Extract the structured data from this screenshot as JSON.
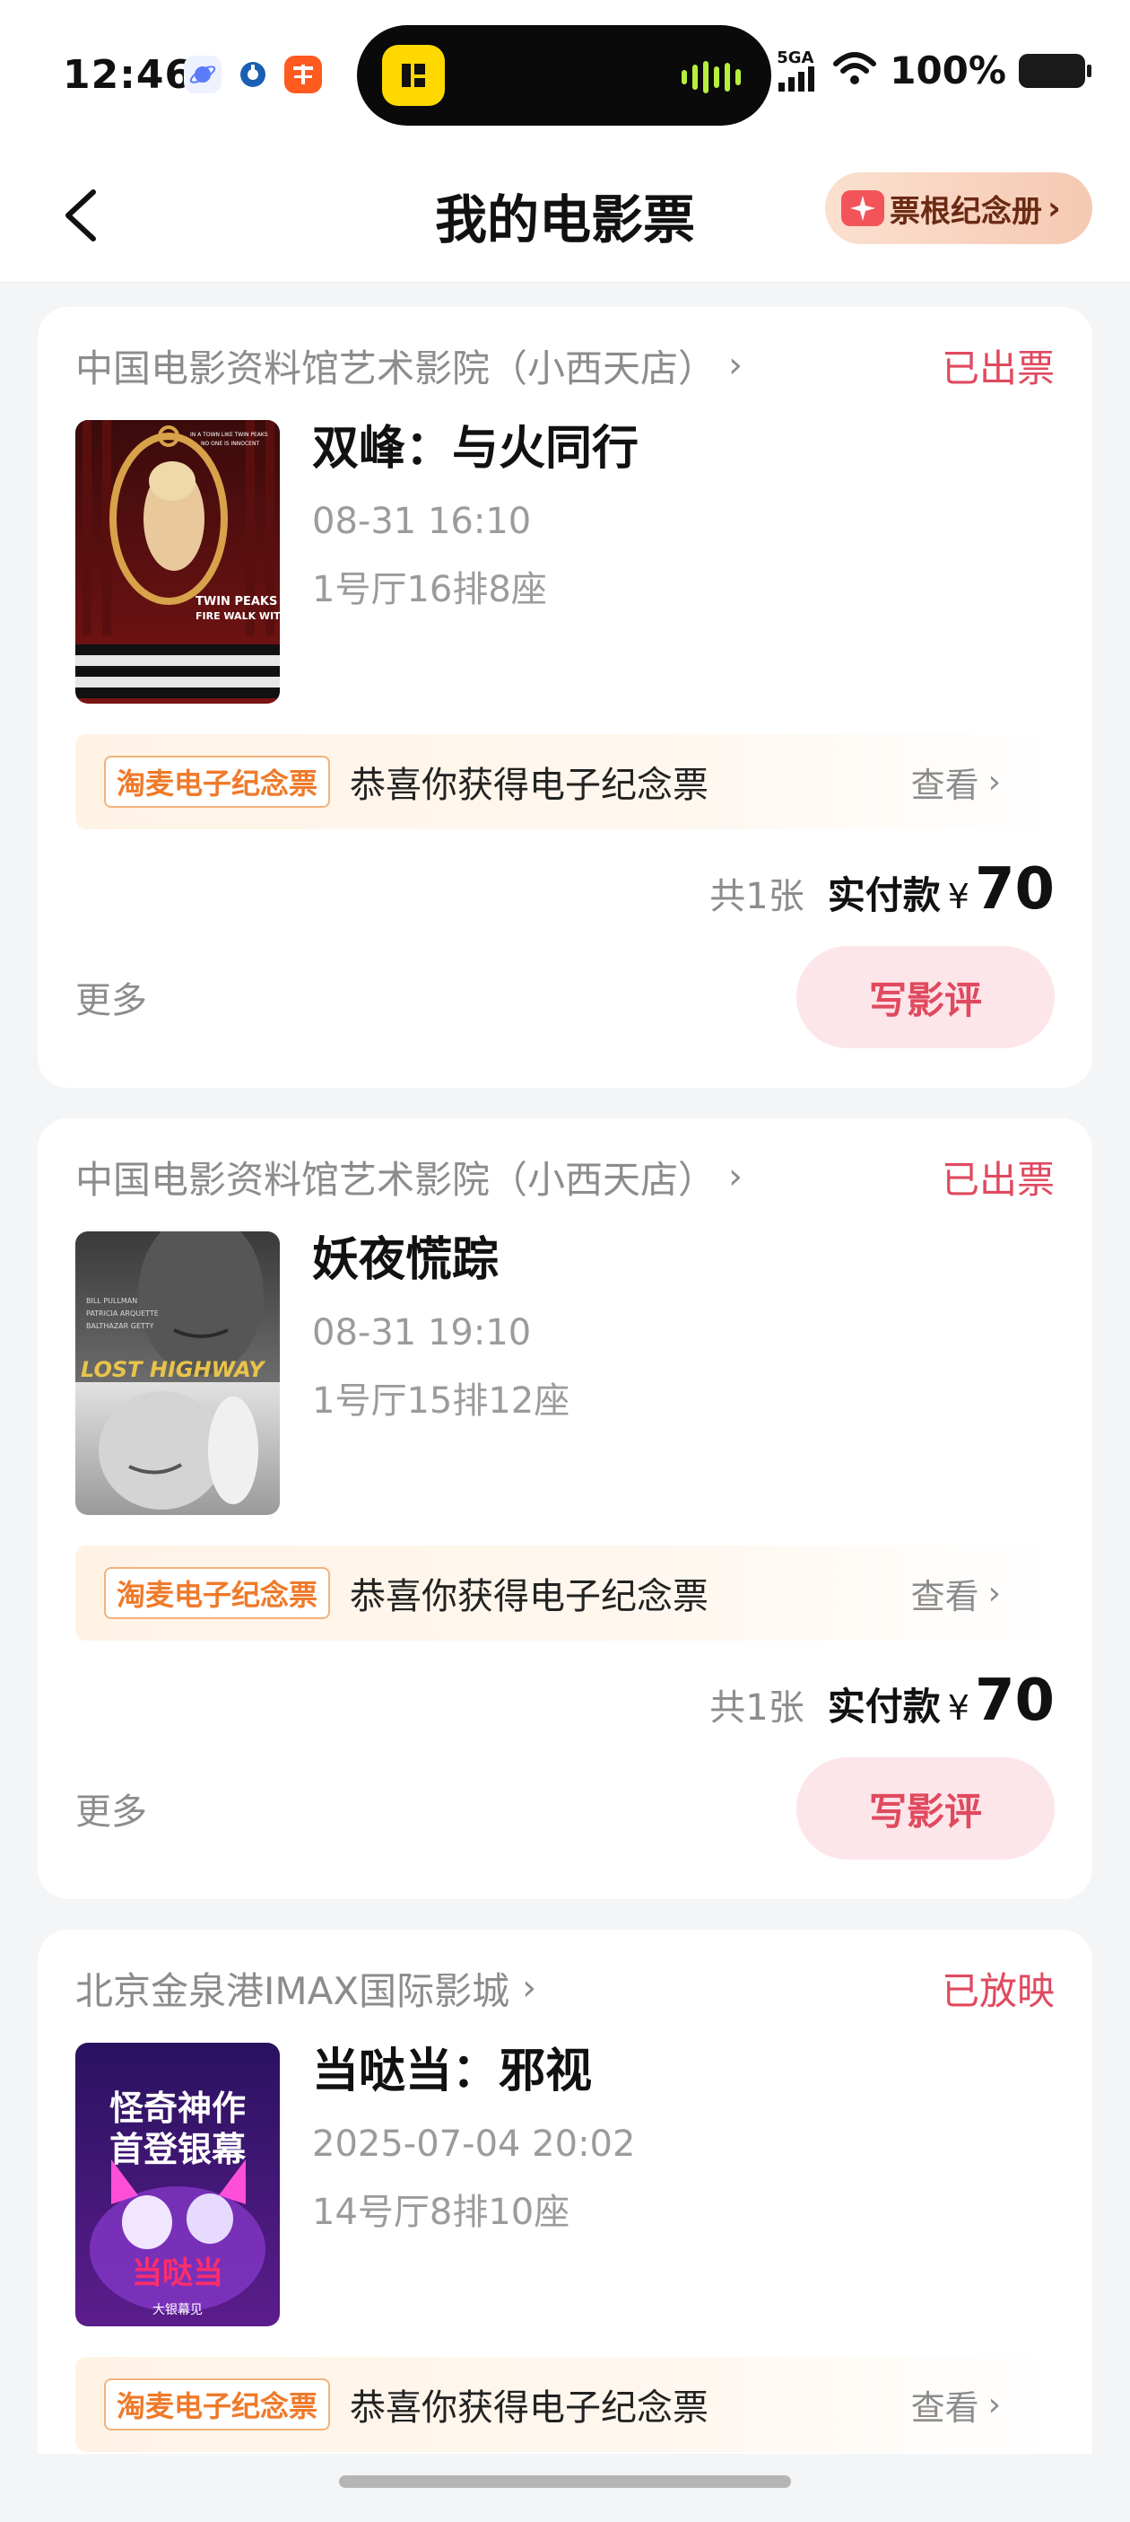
{
  "status_bar": {
    "time": "12:46",
    "network": "5GA",
    "battery": "100%"
  },
  "nav": {
    "title": "我的电影票",
    "stub_album_label": "票根纪念册"
  },
  "orders": [
    {
      "cinema": "中国电影资料馆艺术影院（小西天店）",
      "status": "已出票",
      "title": "双峰：与火同行",
      "time": "08-31 16:10",
      "seat": "1号厅16排8座",
      "memorial_tag": "淘麦电子纪念票",
      "memorial_text": "恭喜你获得电子纪念票",
      "memorial_view": "查看",
      "count": "共1张",
      "paid_label": "实付款",
      "currency": "¥",
      "price": "70",
      "more": "更多",
      "review": "写影评",
      "poster_lines": [
        "IN A TOWN LIKE TWIN PEAKS",
        "NO ONE IS INNOCENT",
        "TWIN PEAKS",
        "FIRE WALK WITH ME"
      ]
    },
    {
      "cinema": "中国电影资料馆艺术影院（小西天店）",
      "status": "已出票",
      "title": "妖夜慌踪",
      "time": "08-31 19:10",
      "seat": "1号厅15排12座",
      "memorial_tag": "淘麦电子纪念票",
      "memorial_text": "恭喜你获得电子纪念票",
      "memorial_view": "查看",
      "count": "共1张",
      "paid_label": "实付款",
      "currency": "¥",
      "price": "70",
      "more": "更多",
      "review": "写影评",
      "poster_lines": [
        "BILL PULLMAN",
        "PATRICIA ARQUETTE",
        "BALTHAZAR GETTY",
        "LOST HIGHWAY"
      ]
    },
    {
      "cinema": "北京金泉港IMAX国际影城",
      "status": "已放映",
      "title": "当哒当：邪视",
      "time": "2025-07-04 20:02",
      "seat": "14号厅8排10座",
      "memorial_tag": "淘麦电子纪念票",
      "memorial_text": "恭喜你获得电子纪念票",
      "memorial_view": "查看",
      "poster_lines": [
        "怪奇神作",
        "首登银幕",
        "当哒当",
        "大银幕见"
      ]
    }
  ],
  "colors": {
    "accent_red": "#e04a5f",
    "memorial_orange": "#ef7a2a",
    "page_bg": "#f4f5f7"
  }
}
